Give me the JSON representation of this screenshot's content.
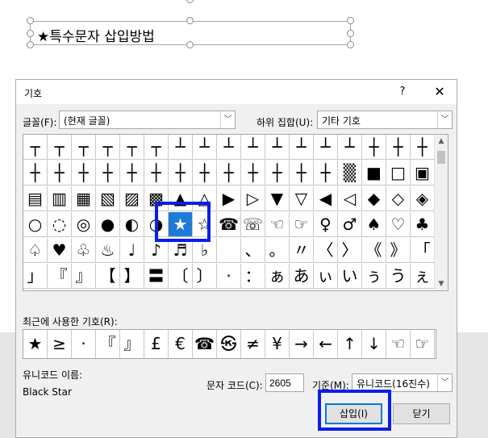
{
  "document": {
    "textbox_text": "★특수문자 삽입방법"
  },
  "dialog": {
    "title": "기호",
    "help_label": "?",
    "close_label": "✕",
    "font_label": "글꼴(F):",
    "font_value": "(현재 글꼴)",
    "subset_label": "하위 집합(U):",
    "subset_value": "기타 기호",
    "symbol_rows": [
      [
        "┬",
        "┬",
        "┬",
        "┬",
        "┬",
        "┬",
        "┴",
        "┴",
        "┴",
        "┴",
        "┴",
        "┴",
        "┴",
        "┴",
        "┼",
        "┼",
        "┼"
      ],
      [
        "┼",
        "┼",
        "┼",
        "┼",
        "┼",
        "┼",
        "┼",
        "┼",
        "┼",
        "┼",
        "┼",
        "┼",
        "┼",
        "▒",
        "■",
        "□",
        "▣"
      ],
      [
        "▤",
        "▥",
        "▦",
        "▧",
        "▨",
        "▩",
        "▲",
        "△",
        "▶",
        "▷",
        "▼",
        "▽",
        "◀",
        "◁",
        "◆",
        "◇",
        "◈"
      ],
      [
        "○",
        "◌",
        "◎",
        "●",
        "◐",
        "◑",
        "★",
        "☆",
        "☎",
        "☏",
        "☜",
        "☞",
        "♀",
        "♂",
        "♠",
        "♡",
        "♣"
      ],
      [
        "♤",
        "♥",
        "♧",
        "♨",
        "♩",
        "♪",
        "♬",
        "♭",
        "",
        "、",
        "。",
        "〃",
        "〈",
        "〉",
        "《",
        "》",
        "「"
      ],
      [
        "」",
        "『",
        "』",
        "【",
        "】",
        "〓",
        "〔",
        "〕",
        "·",
        "：",
        "ぁ",
        "あ",
        "ぃ",
        "い",
        "ぅ",
        "う",
        "ぇ"
      ]
    ],
    "selected_symbol": "★",
    "recent_label": "최근에 사용한 기호(R):",
    "recent_symbols": [
      "★",
      "≥",
      "·",
      "『",
      "』",
      "£",
      "€",
      "☎",
      "㉿",
      "≠",
      "¥",
      "→",
      "←",
      "↑",
      "↓",
      "☜",
      "☞"
    ],
    "unicode_name_label": "유니코드 이름:",
    "unicode_name_value": "Black Star",
    "char_code_label": "문자 코드(C):",
    "char_code_value": "2605",
    "from_label": "기준(M):",
    "from_value": "유니코드(16진수)",
    "insert_label": "삽입(I)",
    "close_button_label": "닫기"
  },
  "colors": {
    "highlight": "#0a1ee8",
    "selection": "#1f7ad6"
  }
}
